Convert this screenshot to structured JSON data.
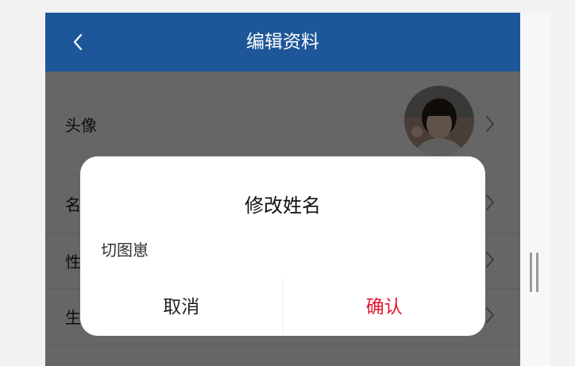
{
  "header": {
    "title": "编辑资料",
    "back_icon": "chevron-left-icon",
    "background": "#1e5799"
  },
  "profile": {
    "rows": [
      {
        "label": "头像",
        "trailing": "avatar-image"
      },
      {
        "label": "名",
        "trailing": "chevron-right-icon"
      },
      {
        "label": "性",
        "trailing": "chevron-right-icon"
      },
      {
        "label": "生",
        "trailing": "chevron-right-icon"
      }
    ]
  },
  "dialog": {
    "title": "修改姓名",
    "input_value": "切图崽",
    "cancel_label": "取消",
    "confirm_label": "确认",
    "confirm_color": "#e5142b"
  },
  "overlay_color": "rgba(0,0,0,0.6)"
}
